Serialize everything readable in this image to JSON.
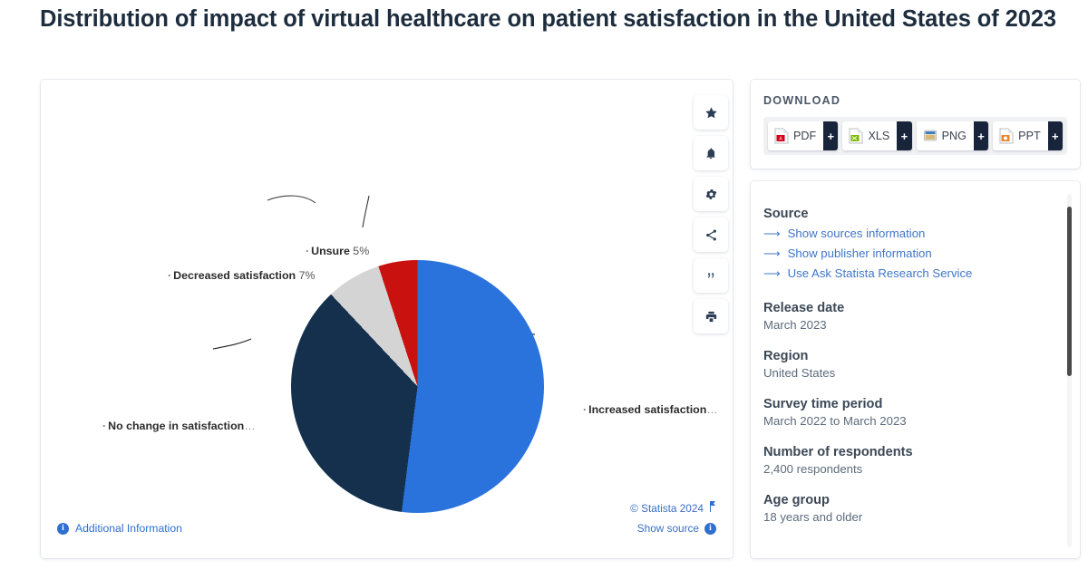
{
  "page": {
    "title": "Distribution of impact of virtual healthcare on patient satisfaction in the United States of 2023"
  },
  "chart_data": {
    "type": "pie",
    "title": "Distribution of impact of virtual healthcare on patient satisfaction in the United States of 2023",
    "categories": [
      "Increased satisfaction…",
      "No change in satisfaction…",
      "Decreased satisfaction",
      "Unsure"
    ],
    "values": [
      52,
      36,
      7,
      5
    ],
    "unit": "%",
    "colors": [
      "#2b73dc",
      "#15304c",
      "#d4d4d4",
      "#c9110f"
    ],
    "legend": "labels-outside",
    "labels": [
      {
        "name": "label-increased",
        "text": "Increased satisfaction",
        "pct": "",
        "suffix": "…"
      },
      {
        "name": "label-nochange",
        "text": "No change in satisfaction",
        "pct": "",
        "suffix": "…"
      },
      {
        "name": "label-decreased",
        "text": "Decreased satisfaction",
        "pct": "7%",
        "suffix": ""
      },
      {
        "name": "label-unsure",
        "text": "Unsure",
        "pct": "5%",
        "suffix": ""
      }
    ],
    "grid": false
  },
  "pie_labels": {
    "unsure": {
      "bullet": "·",
      "name": "Unsure",
      "pct": "5%"
    },
    "decreased": {
      "bullet": "·",
      "name": "Decreased satisfaction",
      "pct": "7%"
    },
    "nochange": {
      "bullet": "·",
      "name": "No change in satisfaction",
      "trunc": "…"
    },
    "increased": {
      "bullet": "·",
      "name": "Increased satisfaction",
      "trunc": "…"
    }
  },
  "chart_toolbar": {
    "items": [
      {
        "icon": "star-icon",
        "label": "Favorite"
      },
      {
        "icon": "bell-icon",
        "label": "Notify"
      },
      {
        "icon": "gear-icon",
        "label": "Settings"
      },
      {
        "icon": "share-icon",
        "label": "Share"
      },
      {
        "icon": "quote-icon",
        "label": "Cite"
      },
      {
        "icon": "print-icon",
        "label": "Print"
      }
    ]
  },
  "chart_footer": {
    "additional_information": "Additional Information",
    "copyright": "© Statista 2024",
    "show_source": "Show source"
  },
  "download": {
    "heading": "DOWNLOAD",
    "buttons": [
      {
        "label": "PDF",
        "plus": "+",
        "color": "#d0021b"
      },
      {
        "label": "XLS",
        "plus": "+",
        "color": "#7ab800"
      },
      {
        "label": "PNG",
        "plus": "+",
        "color": "#3d7fbf"
      },
      {
        "label": "PPT",
        "plus": "+",
        "color": "#e8862b"
      }
    ]
  },
  "info": {
    "source_heading": "Source",
    "links": [
      "Show sources information",
      "Show publisher information",
      "Use Ask Statista Research Service"
    ],
    "blocks": [
      {
        "heading": "Release date",
        "value": "March 2023"
      },
      {
        "heading": "Region",
        "value": "United States"
      },
      {
        "heading": "Survey time period",
        "value": "March 2022 to March 2023"
      },
      {
        "heading": "Number of respondents",
        "value": "2,400 respondents"
      },
      {
        "heading": "Age group",
        "value": "18 years and older"
      }
    ]
  }
}
